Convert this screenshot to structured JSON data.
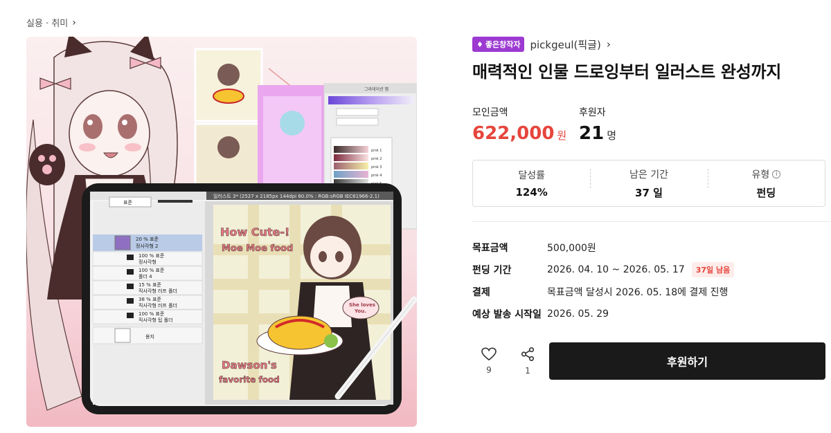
{
  "breadcrumb": {
    "category": "실용 · 취미",
    "chevron": "›"
  },
  "creator": {
    "badge_icon": "diamond-icon",
    "badge_label": "좋은창작자",
    "name": "pickgeul(픽글)",
    "chevron": "›"
  },
  "project": {
    "title": "매력적인 인물 드로잉부터 일러스트 완성까지"
  },
  "stats": {
    "amount_label": "모인금액",
    "amount_value": "622,000",
    "amount_unit": "원",
    "backers_label": "후원자",
    "backers_value": "21",
    "backers_unit": "명"
  },
  "summary": [
    {
      "label": "달성률",
      "value": "124%"
    },
    {
      "label": "남은 기간",
      "value": "37 일"
    },
    {
      "label": "유형",
      "value": "펀딩",
      "icon": "info-icon"
    }
  ],
  "details": {
    "goal_label": "목표금액",
    "goal_value": "500,000원",
    "period_label": "펀딩 기간",
    "period_value": "2026. 04. 10 ~ 2026. 05. 17",
    "period_badge": "37일 남음",
    "payment_label": "결제",
    "payment_value": "목표금액 달성시 2026. 05. 18에 결제 진행",
    "ship_label": "예상 발송 시작일",
    "ship_value": "2026. 05. 29"
  },
  "actions": {
    "like_count": "9",
    "share_count": "1",
    "support_label": "후원하기"
  },
  "hero_texts": {
    "tablet_title": "일러스트 3* (2527 x 2185px 144dpi 60.0% : RGB:sRGB IEC61966-2.1)",
    "art_title_1": "How Cute-!",
    "art_title_2": "Moe Moe food",
    "art_bubble_1": "She loves",
    "art_bubble_2": "You.",
    "art_bottom_1": "Dawson's",
    "art_bottom_2": "favorite food",
    "layers": [
      {
        "pct": "20 % 표준",
        "name": "정사각형 2"
      },
      {
        "pct": "100 % 표준",
        "name": "정사각형"
      },
      {
        "pct": "100 % 표준",
        "name": "폴더 4"
      },
      {
        "pct": "15 % 표준",
        "name": "직사각형 러프 폴더"
      },
      {
        "pct": "38 % 표준",
        "name": "직사각형 러프 폴더"
      },
      {
        "pct": "100 % 표준",
        "name": "직사각형 팁 폴더"
      },
      {
        "pct": "",
        "name": "용지"
      }
    ],
    "blend_mode": "표준",
    "gradient_panel_title": "그라데이션 맵",
    "gradient_items": [
      "pink 1",
      "pink 2",
      "pink 3",
      "pink 4",
      "pink 5"
    ]
  },
  "colors": {
    "accent": "#e6453c",
    "badge": "#9c3ad1",
    "button": "#1a1a1a"
  }
}
